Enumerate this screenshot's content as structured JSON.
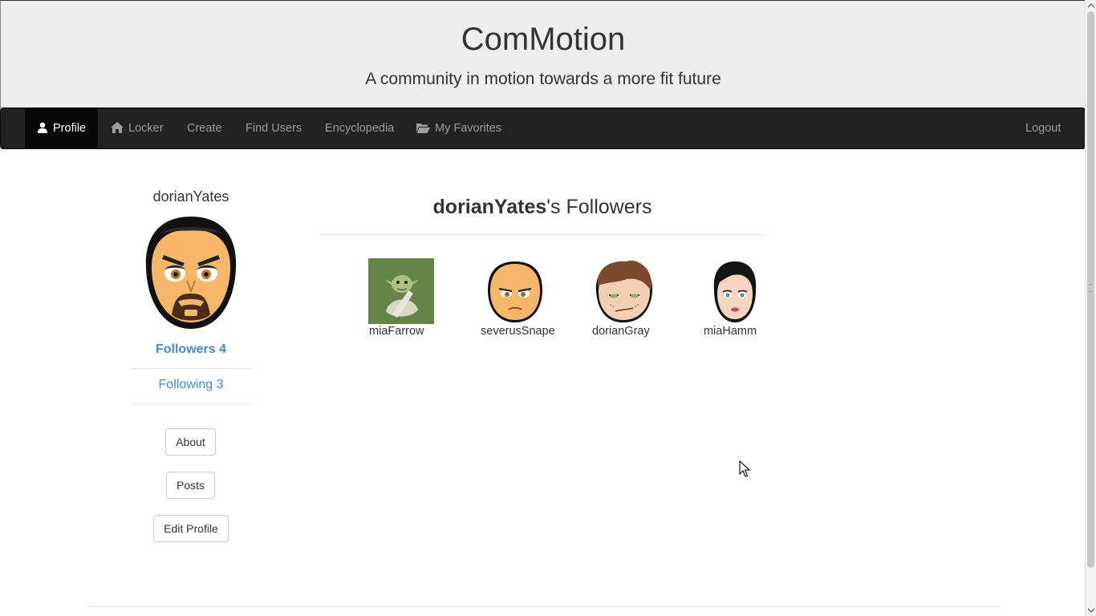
{
  "site": {
    "title": "ComMotion",
    "tagline": "A community in motion towards a more fit future"
  },
  "nav": {
    "items": [
      {
        "label": "Profile",
        "icon": "user-icon",
        "active": true
      },
      {
        "label": "Locker",
        "icon": "home-icon"
      },
      {
        "label": "Create"
      },
      {
        "label": "Find Users"
      },
      {
        "label": "Encyclopedia"
      },
      {
        "label": "My Favorites",
        "icon": "folder-open-icon"
      }
    ],
    "logout": "Logout"
  },
  "sidebar": {
    "username": "dorianYates",
    "followers_label": "Followers 4",
    "following_label": "Following 3",
    "buttons": {
      "about": "About",
      "posts": "Posts",
      "edit_profile": "Edit Profile"
    }
  },
  "main": {
    "title_user": "dorianYates",
    "title_suffix": "'s Followers",
    "followers": [
      {
        "name": "miaFarrow",
        "avatar": "yoda-avatar"
      },
      {
        "name": "severusSnape",
        "avatar": "bald-man-avatar"
      },
      {
        "name": "dorianGray",
        "avatar": "brown-hair-man-avatar"
      },
      {
        "name": "miaHamm",
        "avatar": "dark-hair-woman-avatar"
      }
    ]
  },
  "colors": {
    "link": "#428bca",
    "navbar_bg": "#222222",
    "navbar_active": "#080808",
    "jumbotron_bg": "#eeeeee"
  }
}
